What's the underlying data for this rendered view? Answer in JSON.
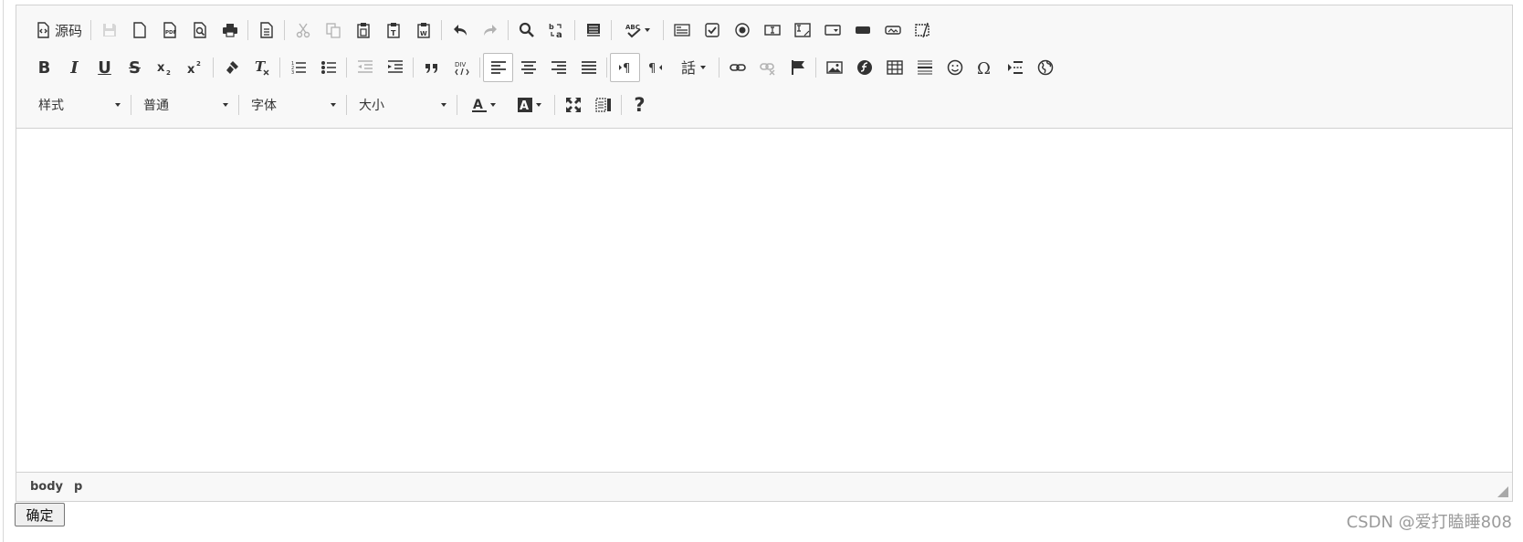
{
  "toolbar": {
    "source_label": "源码",
    "styles_combo": "样式",
    "format_combo": "普通",
    "font_combo": "字体",
    "size_combo": "大小",
    "help_label": "?"
  },
  "pathbar": {
    "items": [
      "body",
      "p"
    ]
  },
  "form": {
    "submit_label": "确定"
  },
  "watermark": "CSDN @爱打瞌睡808",
  "colors": {
    "toolbar_bg": "#f8f8f8",
    "border": "#d1d1d1",
    "icon": "#333333"
  }
}
